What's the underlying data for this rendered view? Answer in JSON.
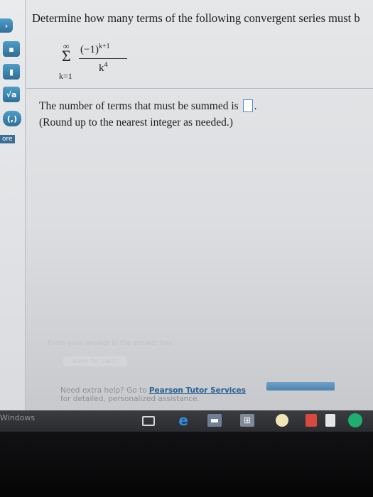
{
  "question": {
    "text": "Determine how many terms of the following convergent series must b"
  },
  "series": {
    "upper": "∞",
    "sigma": "Σ",
    "lower": "k=1",
    "numerator_base": "(−1)",
    "numerator_exp": "k+1",
    "denominator_base": "k",
    "denominator_exp": "4"
  },
  "answer": {
    "prefix": "The number of terms that must be summed is ",
    "suffix": ".",
    "note": "(Round up to the nearest integer as needed.)"
  },
  "toolbar": {
    "tools": [
      "",
      "",
      "",
      "√a",
      "(,)"
    ],
    "more_label": "ore"
  },
  "footer": {
    "enter_hint": "Enter your answer in the answer box.",
    "save_label": "Save for Later",
    "help_prefix": "Need extra help? Go to ",
    "help_link": "Pearson Tutor Services",
    "help_line2": "for detailed, personalized assistance."
  },
  "taskbar": {
    "windows_label": "Windows",
    "icons": [
      "task-view-icon",
      "edge-icon",
      "file-explorer-icon",
      "store-icon",
      "app-round-icon",
      "app-red-icon",
      "app-white-icon",
      "app-green-icon"
    ]
  }
}
